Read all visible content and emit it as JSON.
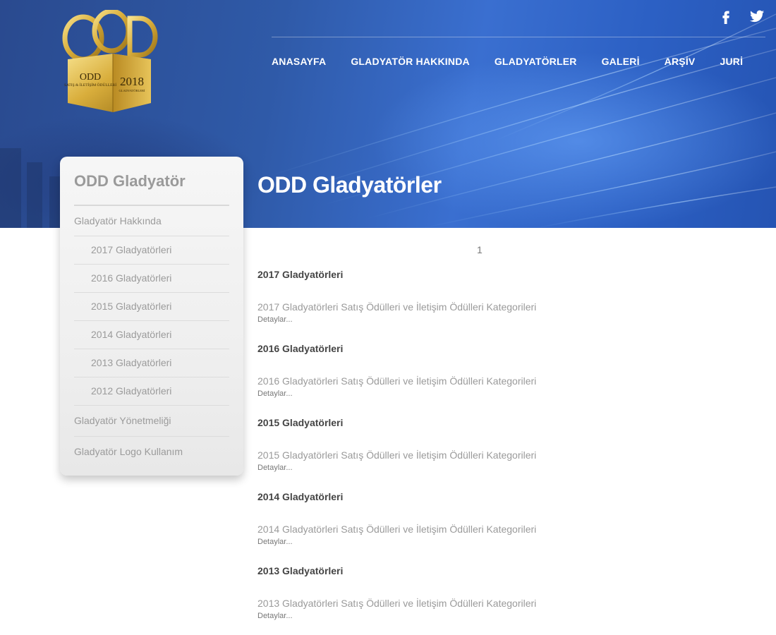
{
  "header": {
    "nav": [
      {
        "label": "ANASAYFA"
      },
      {
        "label": "GLADYATÖR HAKKINDA"
      },
      {
        "label": "GLADYATÖRLER"
      },
      {
        "label": "GALERİ"
      },
      {
        "label": "ARŞİV"
      },
      {
        "label": "JURİ"
      }
    ],
    "social": [
      "facebook-icon",
      "twitter-icon"
    ],
    "logo": {
      "top": "ODD",
      "left": "ODD",
      "left_sub": "SATIŞ & İLETİŞİM ÖDÜLLERİ",
      "year": "2018",
      "year_sub": "GLADYATÖRLERİ"
    }
  },
  "page": {
    "heading": "ODD Gladyatörler"
  },
  "sidebar": {
    "title": "ODD Gladyatör",
    "items": [
      {
        "label": "Gladyatör Hakkında"
      },
      {
        "label": "2017 Gladyatörleri"
      },
      {
        "label": "2016 Gladyatörleri"
      },
      {
        "label": "2015 Gladyatörleri"
      },
      {
        "label": "2014 Gladyatörleri"
      },
      {
        "label": "2013 Gladyatörleri"
      },
      {
        "label": "2012 Gladyatörleri"
      },
      {
        "label": "Gladyatör Yönetmeliği"
      },
      {
        "label": "Gladyatör Logo Kullanım"
      }
    ]
  },
  "content": {
    "pager": "1",
    "more_label": "Detaylar...",
    "entries": [
      {
        "title": "2017 Gladyatörleri",
        "desc": "2017 Gladyatörleri Satış Ödülleri ve İletişim Ödülleri Kategorileri"
      },
      {
        "title": "2016 Gladyatörleri",
        "desc": "2016 Gladyatörleri Satış Ödülleri ve İletişim Ödülleri Kategorileri"
      },
      {
        "title": "2015 Gladyatörleri",
        "desc": "2015 Gladyatörleri Satış Ödülleri ve İletişim Ödülleri Kategorileri"
      },
      {
        "title": "2014 Gladyatörleri",
        "desc": "2014 Gladyatörleri Satış Ödülleri ve İletişim Ödülleri Kategorileri"
      },
      {
        "title": "2013 Gladyatörleri",
        "desc": "2013 Gladyatörleri Satış Ödülleri ve İletişim Ödülleri Kategorileri"
      }
    ]
  },
  "colors": {
    "hero": "#2f5aa8",
    "sidebar_text": "#9b9b9b",
    "gold": "#c9a227"
  }
}
